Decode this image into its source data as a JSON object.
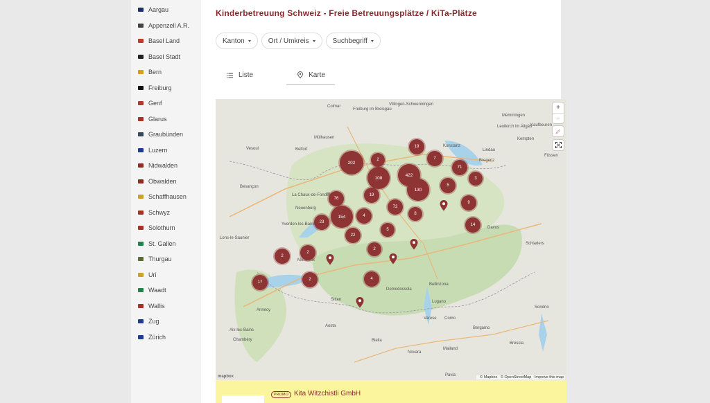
{
  "title": "Kinderbetreuung Schweiz - Freie Betreuungsplätze / KiTa-Plätze",
  "sidebar": {
    "items": [
      {
        "label": "Aargau",
        "color": "#1f2f6b"
      },
      {
        "label": "Appenzell A.R.",
        "color": "#444444"
      },
      {
        "label": "Basel Land",
        "color": "#c0392b"
      },
      {
        "label": "Basel Stadt",
        "color": "#222222"
      },
      {
        "label": "Bern",
        "color": "#d4a017"
      },
      {
        "label": "Freiburg",
        "color": "#111111"
      },
      {
        "label": "Genf",
        "color": "#b03a2e"
      },
      {
        "label": "Glarus",
        "color": "#a93226"
      },
      {
        "label": "Graubünden",
        "color": "#34495e"
      },
      {
        "label": "Luzern",
        "color": "#1f3a93"
      },
      {
        "label": "Nidwalden",
        "color": "#922b21"
      },
      {
        "label": "Obwalden",
        "color": "#922b21"
      },
      {
        "label": "Schaffhausen",
        "color": "#c9a227"
      },
      {
        "label": "Schwyz",
        "color": "#a93226"
      },
      {
        "label": "Solothurn",
        "color": "#a93226"
      },
      {
        "label": "St. Gallen",
        "color": "#1e8449"
      },
      {
        "label": "Thurgau",
        "color": "#5d6d2e"
      },
      {
        "label": "Uri",
        "color": "#c9a227"
      },
      {
        "label": "Waadt",
        "color": "#1e8449"
      },
      {
        "label": "Wallis",
        "color": "#a93226"
      },
      {
        "label": "Zug",
        "color": "#1f3a93"
      },
      {
        "label": "Zürich",
        "color": "#1f3a93"
      }
    ]
  },
  "filters": {
    "kanton": "Kanton",
    "ort": "Ort / Umkreis",
    "suchbegriff": "Suchbegriff"
  },
  "tabs": {
    "liste": "Liste",
    "karte": "Karte"
  },
  "map": {
    "zoom_in": "+",
    "zoom_out": "−",
    "attribution_mapbox": "© Mapbox",
    "attribution_osm": "© OpenStreetMap",
    "attribution_improve": "Improve this map",
    "logo": "mapbox",
    "clusters": [
      {
        "count": "19"
      },
      {
        "count": "7"
      },
      {
        "count": "202"
      },
      {
        "count": "2"
      },
      {
        "count": "108"
      },
      {
        "count": "422"
      },
      {
        "count": "71"
      },
      {
        "count": "3"
      },
      {
        "count": "130"
      },
      {
        "count": "5"
      },
      {
        "count": "19"
      },
      {
        "count": "76"
      },
      {
        "count": "72"
      },
      {
        "count": "9"
      },
      {
        "count": "4"
      },
      {
        "count": "154"
      },
      {
        "count": "8"
      },
      {
        "count": "23"
      },
      {
        "count": "14"
      },
      {
        "count": "5"
      },
      {
        "count": "22"
      },
      {
        "count": "2"
      },
      {
        "count": "2"
      },
      {
        "count": "2"
      },
      {
        "count": "2"
      },
      {
        "count": "4"
      },
      {
        "count": "17"
      }
    ],
    "place_labels": [
      "Colmar",
      "Freiburg im Breisgau",
      "Villingen-Schwenningen",
      "Memmingen",
      "Kaufbeuren",
      "Mülhausen",
      "Leutkirch im Allgäu",
      "Kempten",
      "Konstanz",
      "Lindau",
      "Bregenz",
      "Füssen",
      "Vesoul",
      "Belfort",
      "Besançon",
      "La Chaux-de-Fonds",
      "Biel",
      "Neuenburg",
      "Yverdon-les-Bains",
      "Lons-le-Saunier",
      "Montreux",
      "Sitten",
      "Annecy",
      "Aix-les-Bains",
      "Chambéry",
      "Aosta",
      "Biella",
      "Novara",
      "Mailand",
      "Bergamo",
      "Brescia",
      "Lugano",
      "Varese",
      "Como",
      "Bellinzona",
      "Sondrio",
      "Davos",
      "Schladers",
      "Domodossola",
      "Pavia"
    ],
    "colors": {
      "cluster": "#8f3434",
      "water": "#a8d2ea",
      "land": "#e6e6df",
      "green": "#c8dcb4"
    }
  },
  "promo": {
    "badge": "PROMO",
    "name": "Kita Witzchistli GmbH"
  }
}
